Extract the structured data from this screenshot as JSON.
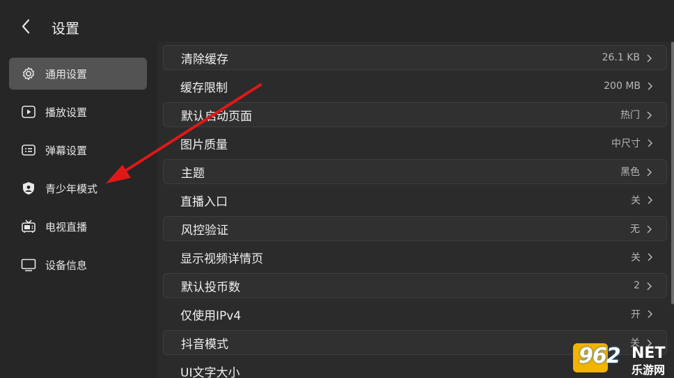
{
  "header": {
    "title": "设置"
  },
  "sidebar": {
    "items": [
      {
        "label": "通用设置",
        "icon": "gear-icon",
        "active": true
      },
      {
        "label": "播放设置",
        "icon": "play-icon",
        "active": false
      },
      {
        "label": "弹幕设置",
        "icon": "danmaku-icon",
        "active": false
      },
      {
        "label": "青少年模式",
        "icon": "shield-icon",
        "active": false
      },
      {
        "label": "电视直播",
        "icon": "tv-antenna-icon",
        "active": false
      },
      {
        "label": "设备信息",
        "icon": "monitor-icon",
        "active": false
      }
    ]
  },
  "settings": [
    {
      "label": "清除缓存",
      "value": "26.1 KB"
    },
    {
      "label": "缓存限制",
      "value": "200 MB"
    },
    {
      "label": "默认启动页面",
      "value": "热门"
    },
    {
      "label": "图片质量",
      "value": "中尺寸"
    },
    {
      "label": "主题",
      "value": "黑色"
    },
    {
      "label": "直播入口",
      "value": "关"
    },
    {
      "label": "风控验证",
      "value": "无"
    },
    {
      "label": "显示视频详情页",
      "value": "关"
    },
    {
      "label": "默认投币数",
      "value": "2"
    },
    {
      "label": "仅使用IPv4",
      "value": "开"
    },
    {
      "label": "抖音模式",
      "value": "关"
    },
    {
      "label": "UI文字大小",
      "value": ""
    }
  ],
  "watermark": {
    "number": "962",
    "suffix": "NET",
    "cn": "乐游网"
  },
  "colors": {
    "background": "#262626",
    "active_item": "#535353",
    "annotation_arrow": "#e01818",
    "watermark_yellow": "#f2b400"
  }
}
